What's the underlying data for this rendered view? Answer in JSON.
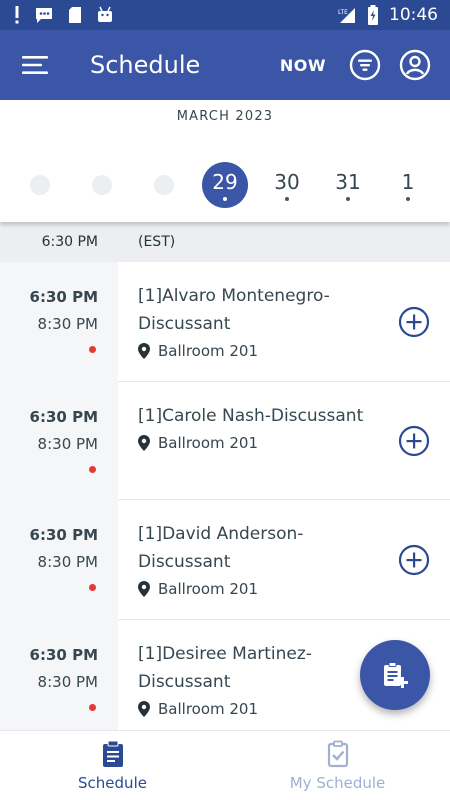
{
  "status_bar": {
    "time": "10:46",
    "network": "LTE",
    "icons": [
      "alert-icon",
      "chat-icon",
      "sd-card-icon",
      "android-icon"
    ]
  },
  "app_bar": {
    "title": "Schedule",
    "now_label": "NOW",
    "color": "#3b56a6"
  },
  "date_strip": {
    "month": "MARCH 2023",
    "days": [
      {
        "label": "",
        "placeholder": true
      },
      {
        "label": "",
        "placeholder": true
      },
      {
        "label": "",
        "placeholder": true
      },
      {
        "label": "29",
        "selected": true,
        "has_events": true
      },
      {
        "label": "30",
        "has_events": true
      },
      {
        "label": "31",
        "has_events": true
      },
      {
        "label": "1",
        "has_events": true
      }
    ]
  },
  "timezone_header": {
    "time": "6:30 PM",
    "label": "(EST)"
  },
  "sessions": [
    {
      "start": "6:30 PM",
      "end": "8:30 PM",
      "title_line1": "[1]Alvaro Montenegro-",
      "title_line2": "Discussant",
      "location": "Ballroom 201"
    },
    {
      "start": "6:30 PM",
      "end": "8:30 PM",
      "title_line1": "[1]Carole Nash-Discussant",
      "title_line2": "",
      "location": "Ballroom 201"
    },
    {
      "start": "6:30 PM",
      "end": "8:30 PM",
      "title_line1": "[1]David Anderson-",
      "title_line2": "Discussant",
      "location": "Ballroom 201"
    },
    {
      "start": "6:30 PM",
      "end": "8:30 PM",
      "title_line1": "[1]Desiree Martinez-",
      "title_line2": "Discussant",
      "location": "Ballroom 201"
    }
  ],
  "bottom_nav": {
    "schedule_label": "Schedule",
    "my_schedule_label": "My Schedule"
  }
}
